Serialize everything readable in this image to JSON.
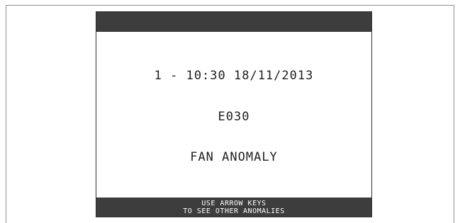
{
  "display": {
    "datetime_line": "1 - 10:30 18/11/2013",
    "error_code": "E030",
    "anomaly_message": "FAN ANOMALY",
    "footer_line_1": "USE ARROW KEYS",
    "footer_line_2": "TO SEE OTHER ANOMALIES"
  },
  "colors": {
    "bar_background": "#3d3d3d",
    "screen_background": "#ffffff",
    "text": "#1f1f1f",
    "footer_text": "#ffffff"
  }
}
